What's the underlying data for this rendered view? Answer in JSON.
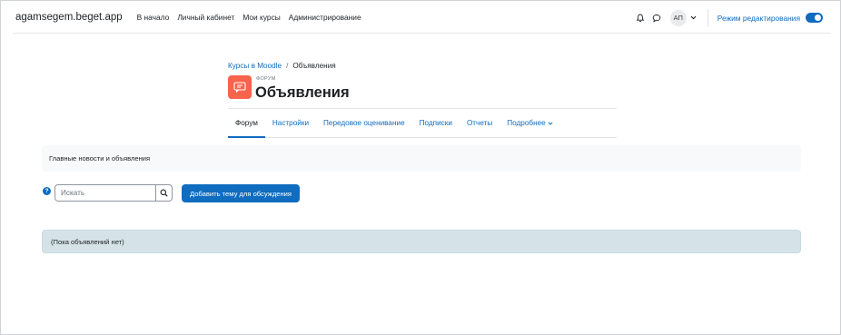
{
  "navbar": {
    "site_name": "agamsegem.beget.app",
    "links": [
      "В начало",
      "Личный кабинет",
      "Мои курсы",
      "Администрирование"
    ],
    "avatar_initials": "АП",
    "edit_mode_label": "Режим редактирования",
    "edit_mode_on": true,
    "accent_color": "#0f6cbf"
  },
  "breadcrumb": {
    "parent": "Курсы в Moodle",
    "separator": "/",
    "current": "Объявления"
  },
  "header": {
    "kicker": "ФОРУМ",
    "title": "Объявления",
    "icon": "forum-icon",
    "icon_color": "#f7634d"
  },
  "secondary_nav": {
    "items": [
      "Форум",
      "Настройки",
      "Передовое оценивание",
      "Подписки",
      "Отчеты",
      "Подробнее"
    ],
    "active_index": 0
  },
  "news": {
    "text": "Главные новости и объявления"
  },
  "search": {
    "placeholder": "Искать"
  },
  "add_topic": {
    "label": "Добавить тему для обсуждения"
  },
  "empty_state": {
    "text": "(Пока объявлений нет)"
  }
}
